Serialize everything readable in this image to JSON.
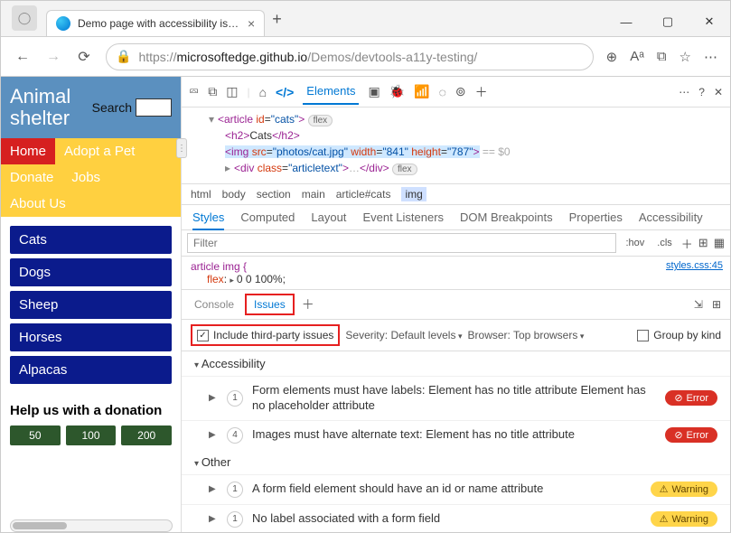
{
  "window": {
    "tab_title": "Demo page with accessibility iss…",
    "url_prefix": "https://",
    "url_host": "microsoftedge.github.io",
    "url_path": "/Demos/devtools-a11y-testing/"
  },
  "page": {
    "title_line1": "Animal",
    "title_line2": "shelter",
    "search_label": "Search",
    "nav": [
      "Home",
      "Adopt a Pet",
      "Donate",
      "Jobs",
      "About Us"
    ],
    "sidebar": [
      "Cats",
      "Dogs",
      "Sheep",
      "Horses",
      "Alpacas"
    ],
    "help_heading": "Help us with a donation",
    "donations": [
      "50",
      "100",
      "200"
    ]
  },
  "devtools": {
    "elements_tab": "Elements",
    "dom": {
      "article_open": "<article id=\"cats\">",
      "flex_badge": "flex",
      "h2": "Cats",
      "img_src": "photos/cat.jpg",
      "img_w": "841",
      "img_h": "787",
      "eq0": "== $0",
      "div_open": "<div class=\"articletext\">",
      "div_close": "</div>"
    },
    "crumbs": [
      "html",
      "body",
      "section",
      "main",
      "article#cats",
      "img"
    ],
    "styles_tabs": [
      "Styles",
      "Computed",
      "Layout",
      "Event Listeners",
      "DOM Breakpoints",
      "Properties",
      "Accessibility"
    ],
    "filter_placeholder": "Filter",
    "hov": ":hov",
    "cls": ".cls",
    "css_selector": "article img {",
    "css_rule": "flex: ▸ 0 0 100%;",
    "css_link": "styles.css:45",
    "drawer": {
      "console": "Console",
      "issues": "Issues"
    },
    "filters": {
      "third_party": "Include third-party issues",
      "severity_label": "Severity:",
      "severity_value": "Default levels",
      "browser_label": "Browser:",
      "browser_value": "Top browsers",
      "group": "Group by kind"
    },
    "categories": [
      "Accessibility",
      "Other"
    ],
    "issues": [
      {
        "count": "1",
        "msg": "Form elements must have labels: Element has no title attribute Element has no placeholder attribute",
        "type": "Error"
      },
      {
        "count": "4",
        "msg": "Images must have alternate text: Element has no title attribute",
        "type": "Error"
      },
      {
        "count": "1",
        "msg": "A form field element should have an id or name attribute",
        "type": "Warning"
      },
      {
        "count": "1",
        "msg": "No label associated with a form field",
        "type": "Warning"
      }
    ]
  }
}
